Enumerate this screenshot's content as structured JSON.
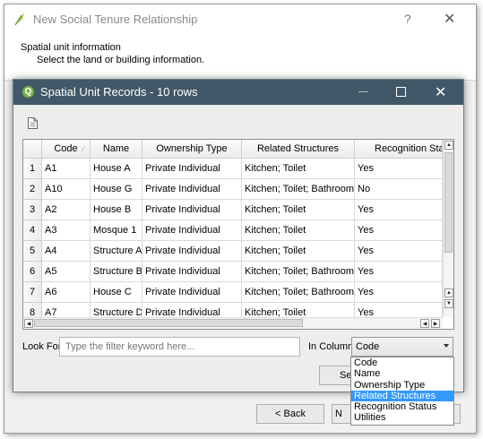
{
  "wizard": {
    "title": "New Social Tenure Relationship",
    "help": "?",
    "close": "✕",
    "heading": "Spatial unit information",
    "subheading": "Select the land or building information.",
    "back_label": "< Back",
    "next_label": "N",
    "cancel_label": ""
  },
  "dialog": {
    "title": "Spatial Unit Records - 10 rows",
    "close": "✕",
    "columns": [
      "Code",
      "Name",
      "Ownership Type",
      "Related Structures",
      "Recognition Stat"
    ],
    "rows": [
      {
        "num": "1",
        "cells": [
          "A1",
          "House A",
          "Private Individual",
          "Kitchen; Toilet",
          "Yes"
        ]
      },
      {
        "num": "2",
        "cells": [
          "A10",
          "House G",
          "Private Individual",
          "Kitchen; Toilet; Bathroom",
          "No"
        ]
      },
      {
        "num": "3",
        "cells": [
          "A2",
          "House B",
          "Private Individual",
          "Kitchen; Toilet",
          "Yes"
        ]
      },
      {
        "num": "4",
        "cells": [
          "A3",
          "Mosque 1",
          "Private Individual",
          "Kitchen; Toilet",
          "Yes"
        ]
      },
      {
        "num": "5",
        "cells": [
          "A4",
          "Structure A",
          "Private Individual",
          "Kitchen; Toilet",
          "Yes"
        ]
      },
      {
        "num": "6",
        "cells": [
          "A5",
          "Structure B",
          "Private Individual",
          "Kitchen; Toilet; Bathroom",
          "Yes"
        ]
      },
      {
        "num": "7",
        "cells": [
          "A6",
          "House C",
          "Private Individual",
          "Kitchen; Toilet; Bathroom",
          "Yes"
        ]
      },
      {
        "num": "8",
        "cells": [
          "A7",
          "Structure D",
          "Private Individual",
          "Kitchen; Toilet",
          "Yes"
        ]
      }
    ],
    "look_for_label": "Look For",
    "filter_placeholder": "Type the filter keyword here...",
    "in_column_label": "In Column",
    "column_selected": "Code",
    "column_options": [
      "Code",
      "Name",
      "Ownership Type",
      "Related Structures",
      "Recognition Status",
      "Utilities"
    ],
    "column_highlighted": "Related Structures",
    "select_label": "Sel"
  }
}
